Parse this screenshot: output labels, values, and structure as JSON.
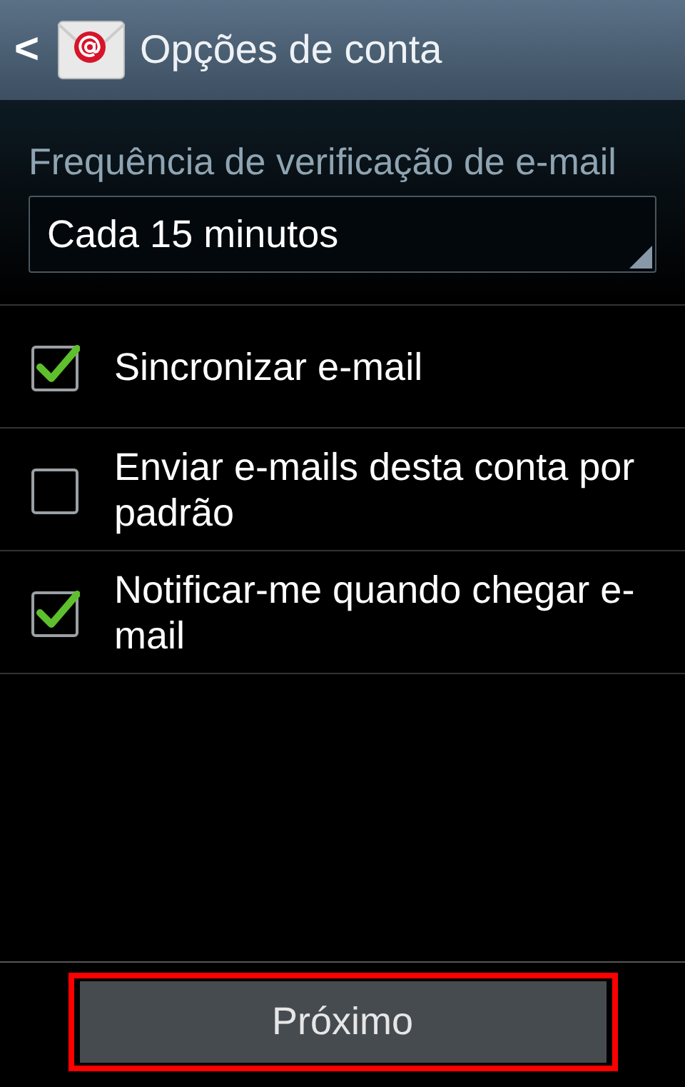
{
  "header": {
    "back": "<",
    "title": "Opções de conta"
  },
  "frequency": {
    "label": "Frequência de verificação de e-mail",
    "value": "Cada 15 minutos"
  },
  "options": [
    {
      "label": "Sincronizar e-mail",
      "checked": true
    },
    {
      "label": "Enviar e-mails desta conta por padrão",
      "checked": false
    },
    {
      "label": "Notificar-me quando chegar e-mail",
      "checked": true
    }
  ],
  "next_button": {
    "label": "Próximo",
    "highlighted": true
  }
}
